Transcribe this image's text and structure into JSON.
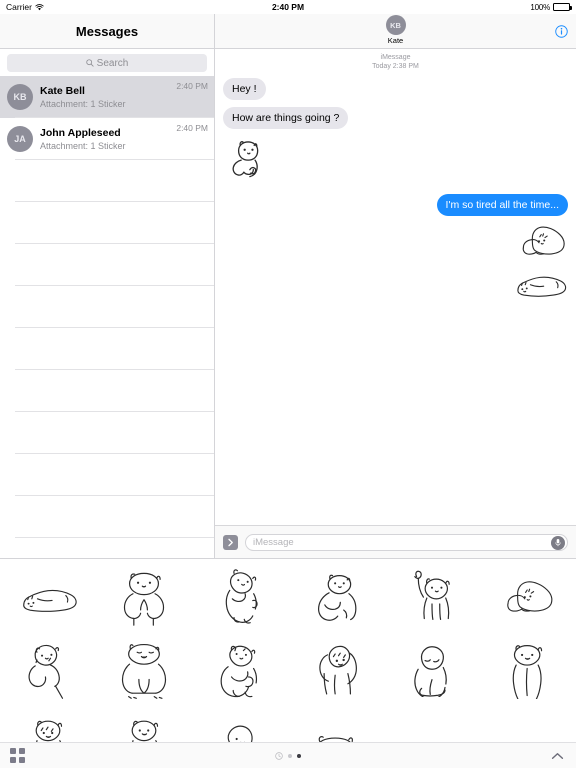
{
  "status_bar": {
    "carrier": "Carrier",
    "wifi_icon": "wifi-icon",
    "time": "2:40 PM",
    "battery_percent": "100%",
    "battery_icon": "battery-full-icon"
  },
  "sidebar": {
    "title": "Messages",
    "search": {
      "placeholder": "Search",
      "icon": "search-icon"
    },
    "conversations": [
      {
        "initials": "KB",
        "name": "Kate Bell",
        "preview": "Attachment: 1 Sticker",
        "time": "2:40 PM",
        "selected": true
      },
      {
        "initials": "JA",
        "name": "John Appleseed",
        "preview": "Attachment: 1 Sticker",
        "time": "2:40 PM",
        "selected": false
      }
    ],
    "empty_row_count": 10
  },
  "conversation": {
    "header": {
      "avatar_initials": "KB",
      "contact_name": "Kate",
      "info_icon": "info-circle-icon"
    },
    "service_label": "iMessage",
    "timestamp": "Today 2:38 PM",
    "messages": [
      {
        "kind": "text",
        "direction": "in",
        "text": "Hey !"
      },
      {
        "kind": "text",
        "direction": "in",
        "text": "How are things going ?"
      },
      {
        "kind": "sticker",
        "direction": "in",
        "sticker": "bear-thinking-sticker"
      },
      {
        "kind": "text",
        "direction": "out",
        "text": "I'm so tired all the time..."
      },
      {
        "kind": "sticker",
        "direction": "out",
        "sticker": "bear-lying-down-sticker"
      },
      {
        "kind": "sticker",
        "direction": "out",
        "sticker": "bear-sleeping-flat-sticker"
      }
    ],
    "input_bar": {
      "expand_icon": "chevron-right-icon",
      "placeholder": "iMessage",
      "value": "",
      "mic_icon": "microphone-icon"
    }
  },
  "sticker_drawer": {
    "stickers": [
      "bear-sleeping-flat-sticker",
      "bear-paws-together-sticker",
      "bear-leaning-sticker",
      "bear-sitting-sticker",
      "bear-waving-sticker",
      "bear-lying-down-sticker",
      "bear-holding-balloon-sticker",
      "bear-sitting-crumbs-sticker",
      "bear-hugging-sticker",
      "bear-hands-up-sticker",
      "bear-sad-sitting-sticker",
      "bear-standing-sticker",
      "bear-peeking-sticker",
      "bear-standing-small-sticker",
      "bear-tilted-head-sticker",
      "bear-crouching-sticker"
    ],
    "toolbar": {
      "apps_icon": "apps-grid-icon",
      "recents_icon": "recents-clock-icon",
      "page_count": 2,
      "active_page": 2,
      "expand_icon": "chevron-up-icon"
    }
  },
  "colors": {
    "accent_blue": "#1a8cff",
    "incoming_bubble": "#e6e5eb",
    "avatar_gray": "#8e8e99",
    "selected_row": "#d9d9de",
    "separator": "#e2e2e5"
  }
}
